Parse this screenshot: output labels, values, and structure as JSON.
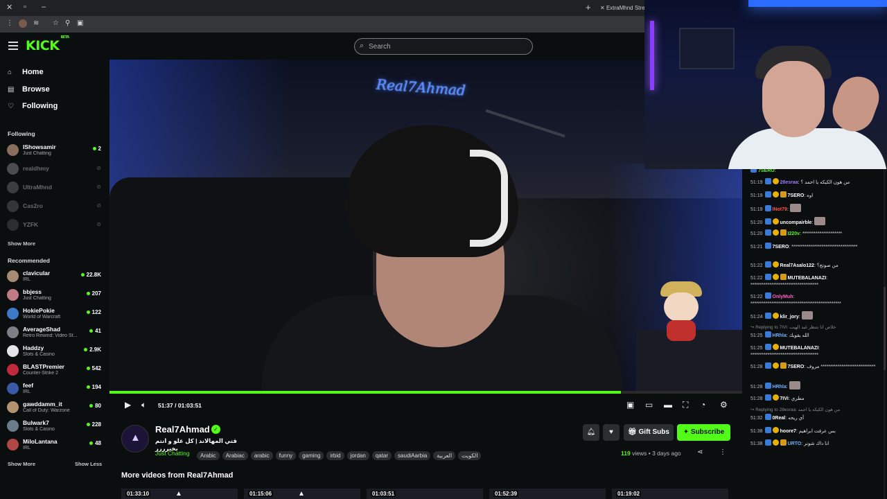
{
  "browser": {
    "tab_title": "ExtraMhnd Strean",
    "new_tab": "+",
    "tab_close": "✕"
  },
  "header": {
    "logo": "KICK",
    "logo_badge": "BETA",
    "search_placeholder": "Search"
  },
  "sidebar": {
    "nav": [
      {
        "label": "Home",
        "icon": "home-icon"
      },
      {
        "label": "Browse",
        "icon": "browse-icon"
      },
      {
        "label": "Following",
        "icon": "heart-icon"
      }
    ],
    "following_title": "Following",
    "following": [
      {
        "name": "IShowsamir",
        "category": "Just Chatting",
        "viewers": "2",
        "live": true,
        "color": "#8a6d5c"
      },
      {
        "name": "realdhmy",
        "live": false,
        "color": "#9a9a9a"
      },
      {
        "name": "UltraMhnd",
        "live": false,
        "color": "#777777"
      },
      {
        "name": "Cas2ro",
        "live": false,
        "color": "#666666"
      },
      {
        "name": "YZFK",
        "live": false,
        "color": "#555555"
      }
    ],
    "show_more": "Show More",
    "recommended_title": "Recommended",
    "recommended": [
      {
        "name": "clavicular",
        "category": "IRL",
        "viewers": "22.8K",
        "color": "#a58a74"
      },
      {
        "name": "bbjess",
        "category": "Just Chatting",
        "viewers": "207",
        "color": "#c07a85"
      },
      {
        "name": "HokiePokie",
        "category": "World of Warcraft",
        "viewers": "122",
        "color": "#3e78c8"
      },
      {
        "name": "AverageShad",
        "category": "Retro Rewind: Video St...",
        "viewers": "41",
        "color": "#7b7f86"
      },
      {
        "name": "Haddzy",
        "category": "Slots & Casino",
        "viewers": "2.9K",
        "color": "#e5e5e5"
      },
      {
        "name": "BLASTPremier",
        "category": "Counter-Strike 2",
        "viewers": "542",
        "color": "#c02a3d"
      },
      {
        "name": "feef",
        "category": "IRL",
        "viewers": "194",
        "color": "#3a5aa8"
      },
      {
        "name": "gawddamm_it",
        "category": "Call of Duty: Warzone",
        "viewers": "80",
        "color": "#b3936e"
      },
      {
        "name": "Bulwark7",
        "category": "Slots & Casino",
        "viewers": "228",
        "color": "#6a7b8c"
      },
      {
        "name": "MiloLantana",
        "category": "IRL",
        "viewers": "48",
        "color": "#b04646"
      }
    ],
    "show_more_2": "Show More",
    "show_less": "Show Less"
  },
  "player": {
    "time_current": "51:37",
    "time_sep": "/",
    "time_total": "01:03:51",
    "progress": 0.808
  },
  "video": {
    "neon_sign": "Real7Ahmad",
    "streamer": "Real7Ahmad",
    "title": "قتي المهالاند | كل علو و انتم بخيرررر",
    "category": "Just Chatting",
    "tags": [
      "Arabic",
      "Arabiac",
      "arabic",
      "funny",
      "gaming",
      "irbid",
      "jordan",
      "qatar",
      "saudiAarbia",
      "العربية",
      "الكويت"
    ],
    "gift_label": "Gift Subs",
    "subscribe_label": "Subscribe",
    "views_count": "119",
    "views_label": "views",
    "date": "3 days ago",
    "more_videos_title": "More videos from Real7Ahmad",
    "more_videos": [
      {
        "duration": "01:33:10"
      },
      {
        "duration": "01:15:06"
      },
      {
        "duration": "01:03:51"
      },
      {
        "duration": "01:52:39"
      },
      {
        "duration": "01:19:02"
      }
    ]
  },
  "chat": [
    {
      "time": "",
      "user": "7SERO",
      "color": "#53fc18",
      "text": "",
      "partial": true
    },
    {
      "time": "51:19",
      "user": "28esraa",
      "color": "#9b7bff",
      "text": "من هون الكيكه يا احمد ؟"
    },
    {
      "time": "51:19",
      "user": "7SERO",
      "color": "#ffffff",
      "text": "اوه"
    },
    {
      "time": "51:19",
      "user": "INot79",
      "color": "#ff4d4d",
      "text": ""
    },
    {
      "time": "51:20",
      "user": "uncompairble",
      "color": "#ffffff",
      "text": ""
    },
    {
      "time": "51:20",
      "user": "I220v",
      "color": "#53fc18",
      "text": "*********************"
    },
    {
      "time": "51:21",
      "user": "7SERO",
      "color": "#ffffff",
      "text": "***********************************"
    },
    {
      "time": "51:22",
      "user": "Real7Asalo122",
      "color": "#ffffff",
      "text": "من صوتج؟"
    },
    {
      "time": "51:22",
      "user": "MUTEBALANAZI",
      "color": "#ffffff",
      "text": "************************************"
    },
    {
      "time": "51:22",
      "user": "OnlyMuh",
      "color": "#ff5cc8",
      "text": "************************************************"
    },
    {
      "time": "51:24",
      "user": "klir_jory",
      "color": "#ffffff",
      "text": ""
    },
    {
      "reply": "Replying to 7IVi: خلاص انا نتنظر غيد الهيب"
    },
    {
      "time": "51:25",
      "user": "HRhla",
      "color": "#6db3ff",
      "text": "الله يقويك"
    },
    {
      "time": "51:25",
      "user": "MUTEBALANAZI",
      "color": "#ffffff",
      "text": "************************************"
    },
    {
      "time": "51:28",
      "user": "7SERO",
      "color": "#ffffff",
      "text": "مروف *****************************"
    },
    {
      "time": "51:28",
      "user": "HRhla",
      "color": "#6db3ff",
      "text": ""
    },
    {
      "time": "51:28",
      "user": "7IVi",
      "color": "#ffffff",
      "text": "مطري"
    },
    {
      "reply": "Replying to 28esraa: من هون الكيكه يا احمد"
    },
    {
      "time": "51:32",
      "user": "0Real",
      "color": "#ffffff",
      "text": "أي ريحه"
    },
    {
      "time": "51:38",
      "user": "hoore7",
      "color": "#ffffff",
      "text": "بس عرفت ابراهيم"
    },
    {
      "time": "51:38",
      "user": "URTO",
      "color": "#6db3ff",
      "text": "انا داك شوتر"
    }
  ]
}
